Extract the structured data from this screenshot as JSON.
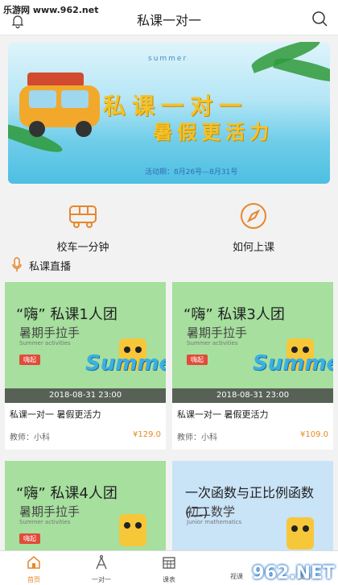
{
  "watermark": "乐游网 www.962.net",
  "header": {
    "title": "私课一对一"
  },
  "banner": {
    "tag": "summer",
    "line1": "私课一对一",
    "line2": "暑假更活力",
    "date": "活动期：8月26号—8月31号"
  },
  "quick_links": [
    {
      "label": "校车一分钟",
      "icon": "bus-icon"
    },
    {
      "label": "如何上课",
      "icon": "compass-icon"
    }
  ],
  "section": {
    "title": "私课直播",
    "icon": "microphone-icon"
  },
  "courses": [
    {
      "title": "“嗨” 私课1人团",
      "subtitle": "暑期手拉手",
      "en": "Summer activities",
      "badge": "嗨起",
      "datetime": "2018-08-31 23:00",
      "name": "私课一对一 暑假更活力",
      "teacher": "教师：小科",
      "price": "¥129.0"
    },
    {
      "title": "“嗨” 私课3人团",
      "subtitle": "暑期手拉手",
      "en": "Summer activities",
      "badge": "嗨起",
      "datetime": "2018-08-31 23:00",
      "name": "私课一对一 暑假更活力",
      "teacher": "教师：小科",
      "price": "¥109.0"
    },
    {
      "title": "“嗨” 私课4人团",
      "subtitle": "暑期手拉手",
      "en": "Summer activities",
      "badge": "嗨起"
    },
    {
      "title": "一次函数与正比例函数(二)",
      "subtitle": "初二数学",
      "en": "Junior mathematics"
    }
  ],
  "tabbar": [
    {
      "label": "首页",
      "icon": "home-icon",
      "active": true
    },
    {
      "label": "一对一",
      "icon": "compass-drafting-icon"
    },
    {
      "label": "课表",
      "icon": "calendar-icon"
    },
    {
      "label": "视课"
    },
    {
      "label": "我的"
    }
  ],
  "watermark2": "962.NET",
  "colors": {
    "accent": "#e8862a",
    "card_green": "#a6df9e",
    "card_blue": "#c9e3f7",
    "price": "#e58a1f"
  }
}
